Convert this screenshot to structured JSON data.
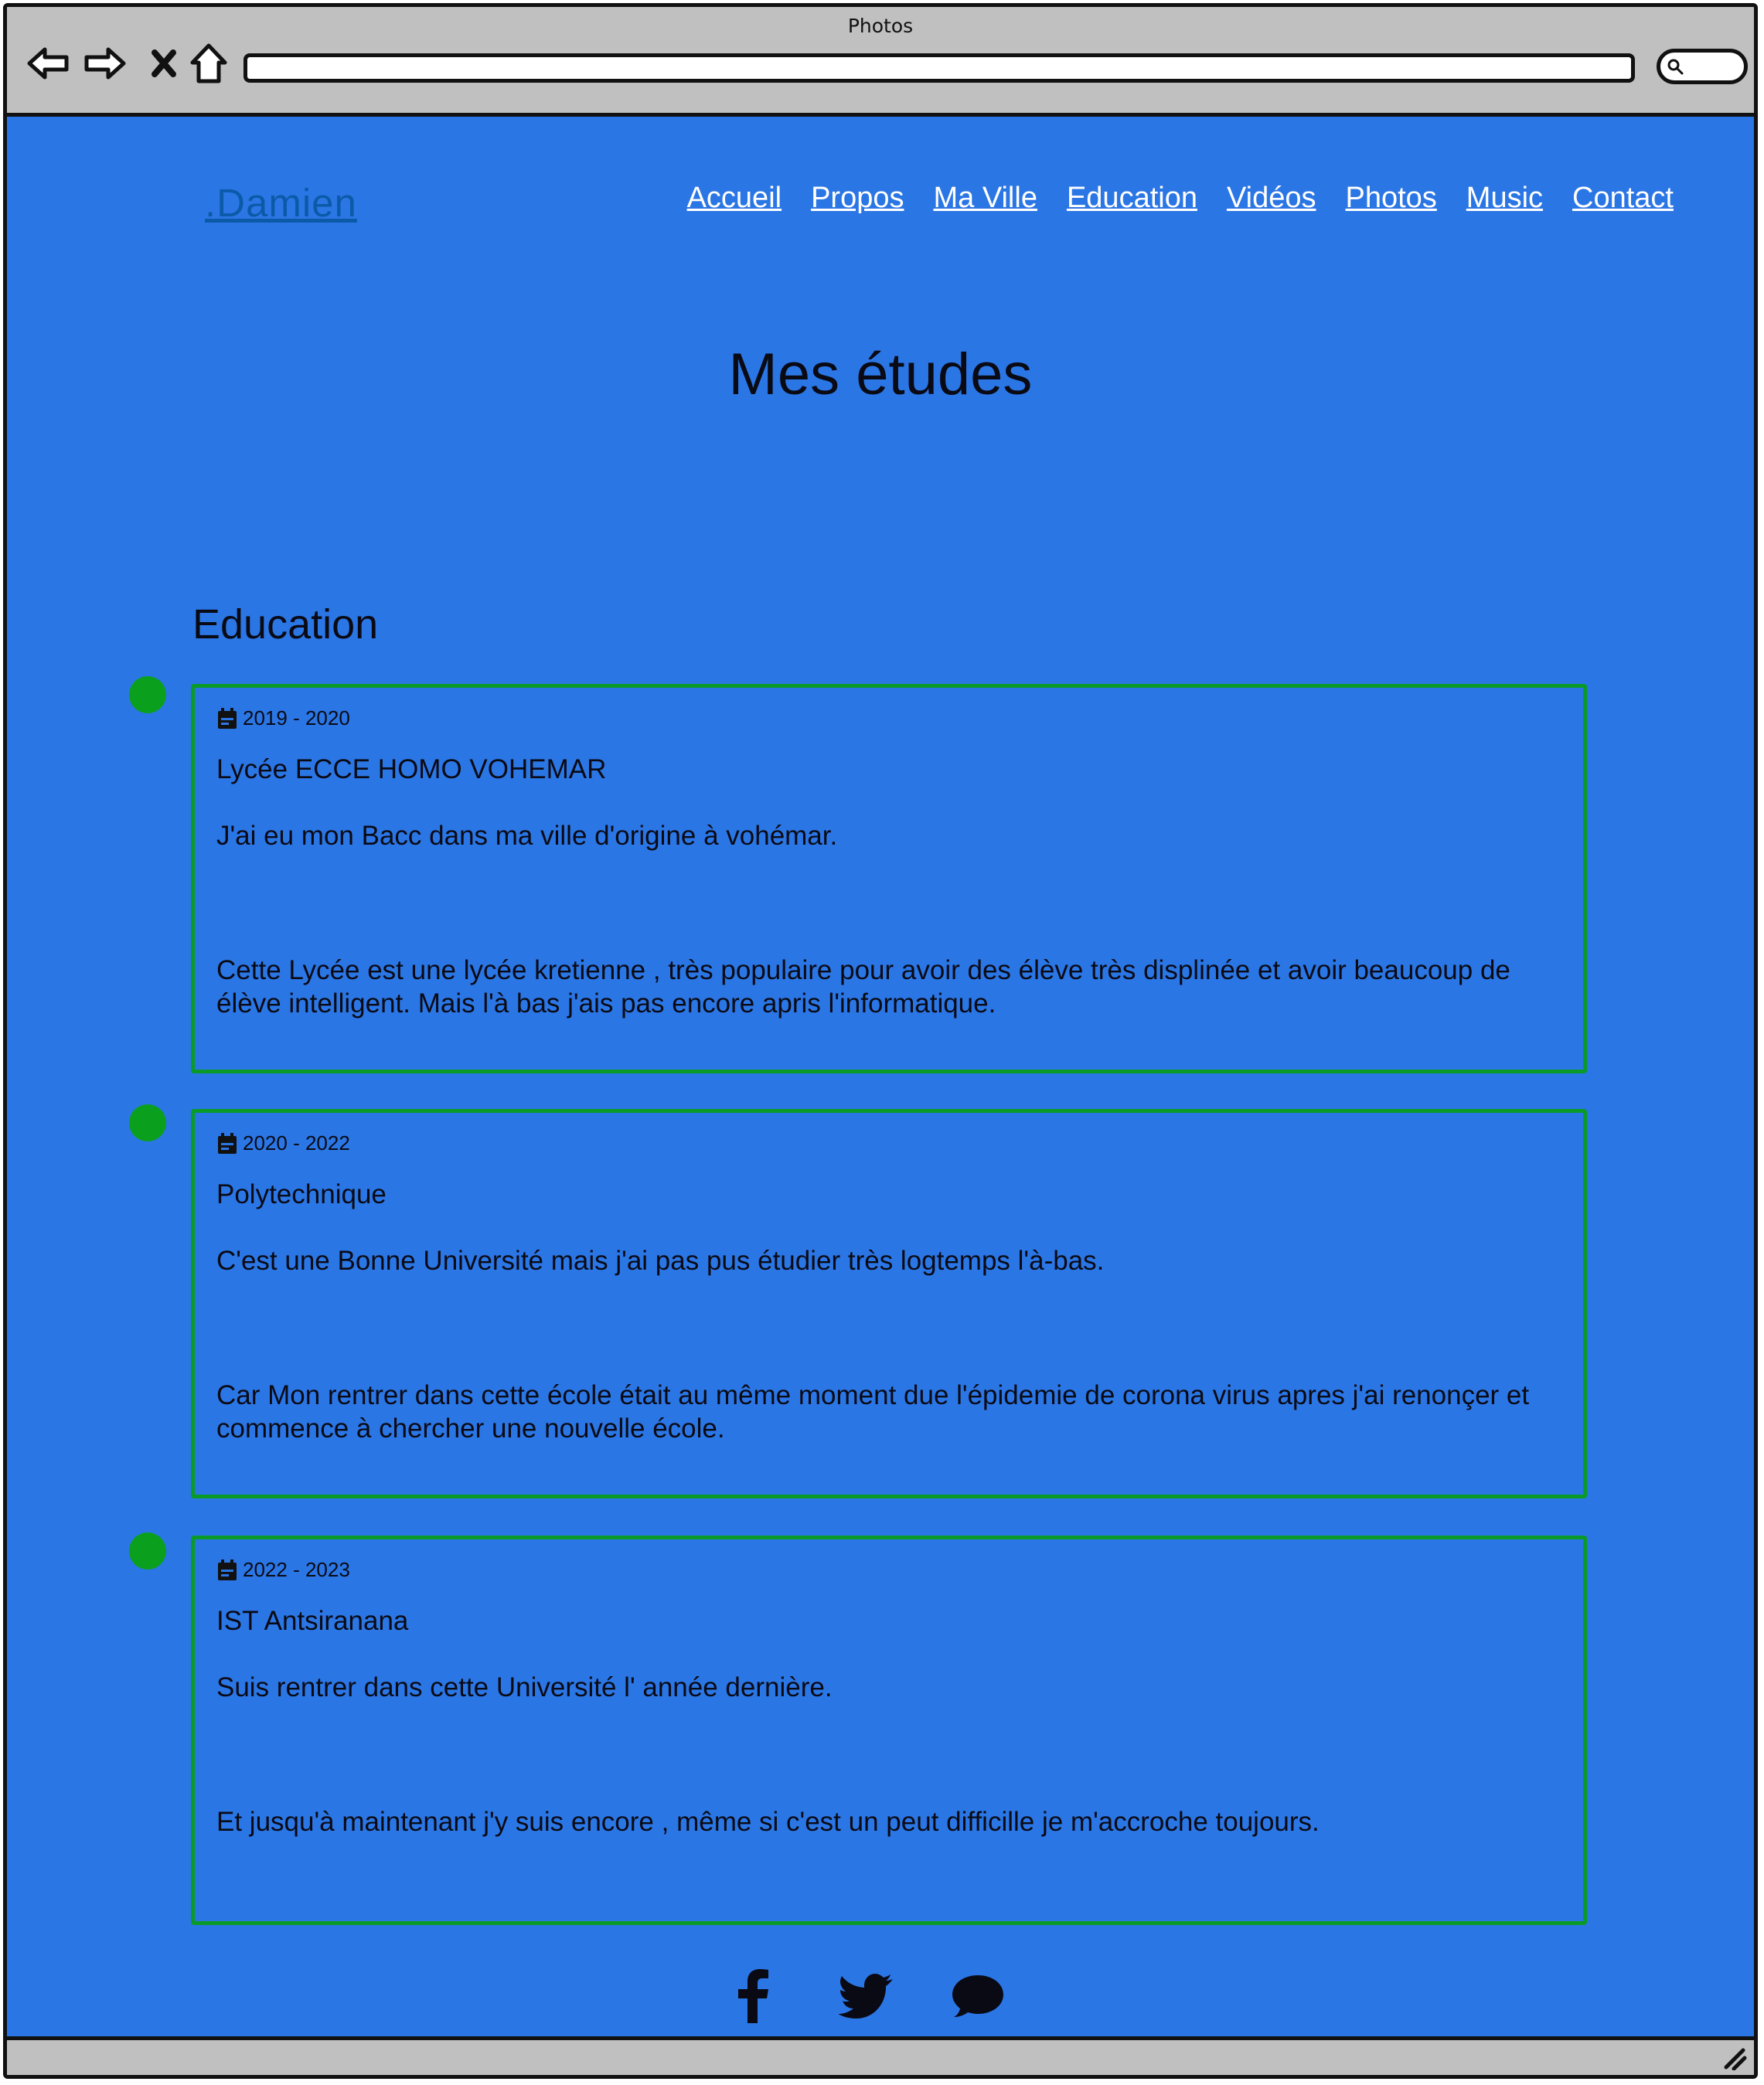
{
  "window": {
    "title": "Photos"
  },
  "site": {
    "brand": ".Damien",
    "nav": [
      "Accueil",
      "Propos",
      "Ma Ville",
      "Education",
      "Vidéos",
      "Photos",
      "Music",
      "Contact"
    ]
  },
  "page": {
    "title": "Mes études",
    "section_title": "Education"
  },
  "education": [
    {
      "years": "2019 - 2020",
      "school": "Lycée ECCE HOMO VOHEMAR",
      "line1": "J'ai eu mon Bacc dans ma ville d'origine à vohémar.",
      "line2": "Cette Lycée est une lycée kretienne , très populaire pour avoir des élève très displinée et avoir beaucoup de élève intelligent. Mais l'à bas j'ais pas encore apris l'informatique."
    },
    {
      "years": "2020 - 2022",
      "school": "Polytechnique",
      "line1": "C'est une Bonne Université mais j'ai pas pus étudier très logtemps l'à-bas.",
      "line2": "Car Mon rentrer dans cette école était au même moment due l'épidemie de corona virus apres j'ai renonçer et commence à chercher une nouvelle école."
    },
    {
      "years": "2022 - 2023",
      "school": "IST Antsiranana",
      "line1": "Suis rentrer dans cette Université l' année dernière.",
      "line2": "Et jusqu'à maintenant j'y suis encore , même si c'est un peut difficille je m'accroche toujours."
    }
  ],
  "social": [
    "facebook-icon",
    "twitter-icon",
    "chat-icon"
  ],
  "colors": {
    "background": "#2b76e5",
    "card_border": "#0a9a28",
    "dot": "#0aa01e",
    "brand": "#0b5aa8"
  }
}
